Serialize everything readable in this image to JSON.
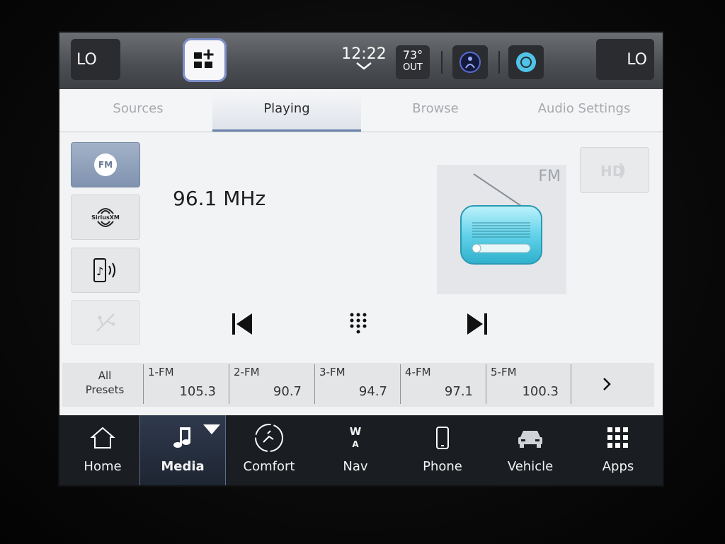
{
  "topbar": {
    "left_climate": "LO",
    "right_climate": "LO",
    "time": "12:22",
    "temp_value": "73°",
    "temp_label": "OUT"
  },
  "tabs": [
    {
      "label": "Sources",
      "active": false
    },
    {
      "label": "Playing",
      "active": true
    },
    {
      "label": "Browse",
      "active": false
    },
    {
      "label": "Audio Settings",
      "active": false
    }
  ],
  "sources": {
    "fm_label": "FM",
    "sirius_label": "SiriusXM"
  },
  "now_playing": {
    "frequency": "96.1 MHz",
    "band": "FM",
    "hd_label": "HD"
  },
  "presets": {
    "all_label_1": "All",
    "all_label_2": "Presets",
    "items": [
      {
        "name": "1-FM",
        "value": "105.3"
      },
      {
        "name": "2-FM",
        "value": "90.7"
      },
      {
        "name": "3-FM",
        "value": "94.7"
      },
      {
        "name": "4-FM",
        "value": "97.1"
      },
      {
        "name": "5-FM",
        "value": "100.3"
      }
    ]
  },
  "nav": {
    "items": [
      {
        "label": "Home"
      },
      {
        "label": "Media"
      },
      {
        "label": "Comfort"
      },
      {
        "label": "Nav"
      },
      {
        "label": "Phone"
      },
      {
        "label": "Vehicle"
      },
      {
        "label": "Apps"
      }
    ],
    "compass_letter_top": "W",
    "compass_letter_arrow": "A"
  },
  "colors": {
    "accent": "#6b84ad",
    "nav_bg": "#1a1d22",
    "alexa": "#4fc3e8"
  }
}
